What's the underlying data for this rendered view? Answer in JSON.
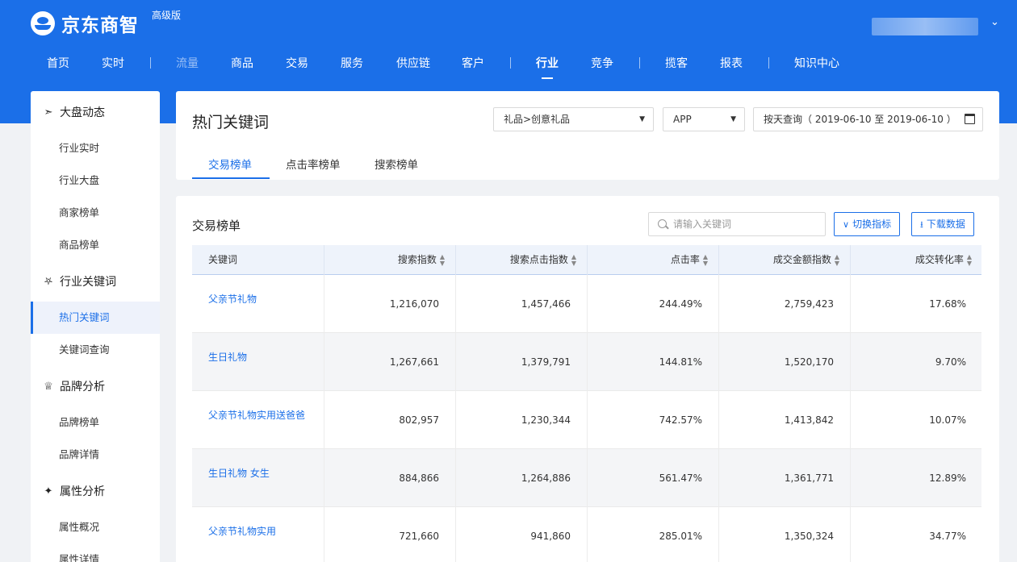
{
  "brand": {
    "name": "京东商智",
    "edition": "高级版"
  },
  "nav": [
    {
      "label": "首页",
      "state": "normal"
    },
    {
      "label": "实时",
      "state": "normal"
    },
    {
      "label": "流量",
      "state": "dim"
    },
    {
      "label": "商品",
      "state": "normal"
    },
    {
      "label": "交易",
      "state": "normal"
    },
    {
      "label": "服务",
      "state": "normal"
    },
    {
      "label": "供应链",
      "state": "normal"
    },
    {
      "label": "客户",
      "state": "normal"
    },
    {
      "label": "行业",
      "state": "active"
    },
    {
      "label": "竞争",
      "state": "normal"
    },
    {
      "label": "揽客",
      "state": "normal"
    },
    {
      "label": "报表",
      "state": "normal"
    },
    {
      "label": "知识中心",
      "state": "normal"
    }
  ],
  "user": {
    "caret_icon": "chevron-down-icon"
  },
  "sidebar": {
    "groups": [
      {
        "label": "大盘动态",
        "icon": "pointer-icon",
        "items": [
          {
            "label": "行业实时"
          },
          {
            "label": "行业大盘"
          },
          {
            "label": "商家榜单"
          },
          {
            "label": "商品榜单"
          }
        ]
      },
      {
        "label": "行业关键词",
        "icon": "shield-icon",
        "items": [
          {
            "label": "热门关键词",
            "active": true
          },
          {
            "label": "关键词查询"
          }
        ]
      },
      {
        "label": "品牌分析",
        "icon": "crown-icon",
        "items": [
          {
            "label": "品牌榜单"
          },
          {
            "label": "品牌详情"
          }
        ]
      },
      {
        "label": "属性分析",
        "icon": "tag-icon",
        "items": [
          {
            "label": "属性概况"
          },
          {
            "label": "属性详情"
          }
        ]
      }
    ]
  },
  "page": {
    "title": "热门关键词",
    "category_select": "礼品>创意礼品",
    "platform_select": "APP",
    "date_range": "按天查询（ 2019-06-10 至 2019-06-10 ）",
    "tabs": [
      {
        "label": "交易榜单",
        "active": true
      },
      {
        "label": "点击率榜单"
      },
      {
        "label": "搜索榜单"
      }
    ]
  },
  "ranking": {
    "title": "交易榜单",
    "search_placeholder": "请输入关键词",
    "switch_button": "切换指标",
    "download_button": "下载数据",
    "columns": [
      "关键词",
      "搜索指数",
      "搜索点击指数",
      "点击率",
      "成交金额指数",
      "成交转化率"
    ],
    "rows": [
      [
        "父亲节礼物",
        "1,216,070",
        "1,457,466",
        "244.49%",
        "2,759,423",
        "17.68%"
      ],
      [
        "生日礼物",
        "1,267,661",
        "1,379,791",
        "144.81%",
        "1,520,170",
        "9.70%"
      ],
      [
        "父亲节礼物实用送爸爸",
        "802,957",
        "1,230,344",
        "742.57%",
        "1,413,842",
        "10.07%"
      ],
      [
        "生日礼物 女生",
        "884,866",
        "1,264,886",
        "561.47%",
        "1,361,771",
        "12.89%"
      ],
      [
        "父亲节礼物实用",
        "721,660",
        "941,860",
        "285.01%",
        "1,350,324",
        "34.77%"
      ]
    ]
  },
  "colors": {
    "brand_blue": "#1b6fe8",
    "page_bg": "#f0f2f5"
  }
}
